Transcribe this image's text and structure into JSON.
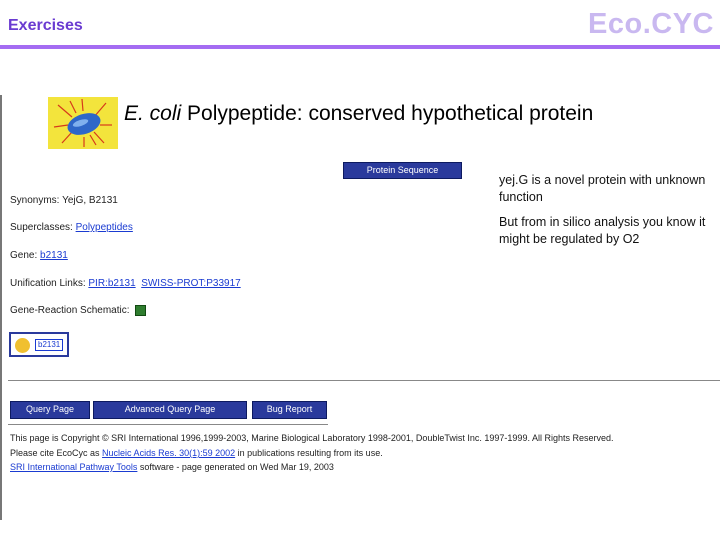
{
  "header": {
    "section_label": "Exercises",
    "brand": "Eco.CYC"
  },
  "page": {
    "title_italic": "E. coli",
    "title_rest": " Polypeptide: conserved hypothetical protein",
    "protein_sequence_button": "Protein Sequence",
    "synonyms_label": "Synonyms: ",
    "synonyms_value": "YejG, B2131",
    "superclasses_label": "Superclasses: ",
    "superclasses_value": "Polypeptides",
    "gene_label": "Gene: ",
    "gene_value": "b2131",
    "unification_label": "Unification Links: ",
    "unification_pir": "PIR:b2131",
    "unification_swiss": "SWISS-PROT:P33917",
    "schematic_label": "Gene-Reaction Schematic: ",
    "icon_label": "b2131"
  },
  "note": {
    "line1": "yej.G is a novel protein with unknown function",
    "line2": "But from in silico analysis you know it might be regulated by O2"
  },
  "toolbar": {
    "query_page": "Query Page",
    "advanced_query_page": "Advanced Query Page",
    "bug_report": "Bug Report"
  },
  "footer": {
    "copyright": "This page is Copyright © SRI International 1996,1999-2003, Marine Biological Laboratory 1998-2001, DoubleTwist Inc. 1997-1999. All Rights Reserved.",
    "cite_prefix": "Please cite EcoCyc as ",
    "cite_link": "Nucleic Acids Res. 30(1):59 2002",
    "cite_suffix": " in publications resulting from its use.",
    "tools_link": "SRI International Pathway Tools",
    "tools_suffix": " software - page generated on Wed Mar 19, 2003"
  }
}
